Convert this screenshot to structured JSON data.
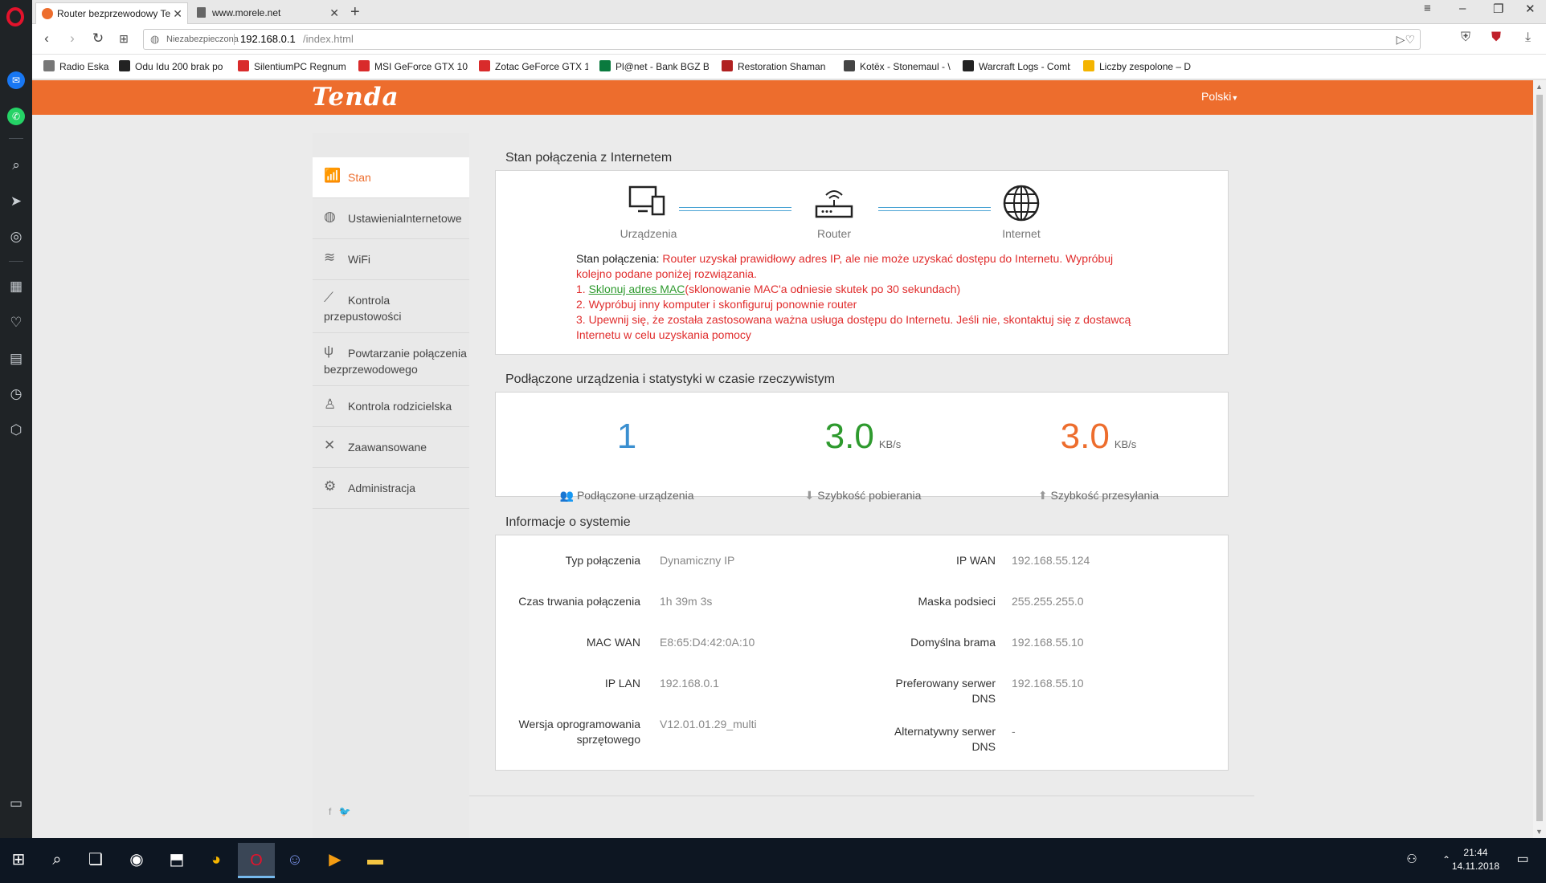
{
  "browser": {
    "tabs": [
      {
        "title": "Router bezprzewodowy Te",
        "active": true
      },
      {
        "title": "www.morele.net",
        "active": false
      }
    ],
    "address": {
      "security": "Niezabezpieczona",
      "host": "192.168.0.1",
      "path": "/index.html"
    },
    "bookmarks": [
      {
        "label": "Radio Eska",
        "color": "#555555"
      },
      {
        "label": "Odu Idu 200 brak po",
        "color": "#222222"
      },
      {
        "label": "SilentiumPC Regnum",
        "color": "#d92b2b"
      },
      {
        "label": "MSI GeForce GTX 10",
        "color": "#d92b2b"
      },
      {
        "label": "Zotac GeForce GTX 1",
        "color": "#d92b2b"
      },
      {
        "label": "Pl@net - Bank BGZ B",
        "color": "#0a7a3e"
      },
      {
        "label": "Restoration Shaman",
        "color": "#b02020"
      },
      {
        "label": "Kotëx - Stonemaul - \\",
        "color": "#444444"
      },
      {
        "label": "Warcraft Logs - Comb",
        "color": "#222222"
      },
      {
        "label": "Liczby zespolone – D",
        "color": "#f4b400"
      }
    ]
  },
  "tenda": {
    "logo": "Tenda",
    "language": "Polski",
    "brand_color": "#ed6d2d",
    "nav": [
      {
        "label": "Stan",
        "icon": "wifi-router-icon",
        "glyph": "🛜"
      },
      {
        "label": "UstawieniaInternetowe",
        "icon": "globe-icon",
        "glyph": "🌐"
      },
      {
        "label": "WiFi",
        "icon": "wifi-icon",
        "glyph": "≋"
      },
      {
        "label_line1": "Kontrola",
        "label_line2": "przepustowości",
        "icon": "chart-line-icon",
        "glyph": "〰"
      },
      {
        "label_line1": "Powtarzanie połączenia",
        "label_line2": "bezprzewodowego",
        "icon": "antenna-icon",
        "glyph": "ψ"
      },
      {
        "label": "Kontrola rodzicielska",
        "icon": "person-icon",
        "glyph": "✦"
      },
      {
        "label": "Zaawansowane",
        "icon": "tools-icon",
        "glyph": "✕"
      },
      {
        "label": "Administracja",
        "icon": "gears-icon",
        "glyph": "⚙"
      }
    ],
    "connection": {
      "title": "Stan połączenia z Internetem",
      "devices_label": "Urządzenia",
      "router_label": "Router",
      "internet_label": "Internet",
      "status_label": "Stan połączenia:",
      "status_text": "Router uzyskał prawidłowy adres IP, ale nie może uzyskać dostępu do Internetu. Wypróbuj kolejno podane poniżej rozwiązania.",
      "step1_prefix": "1.",
      "step1_link": "Sklonuj adres MAC",
      "step1_rest": "(sklonowanie MAC'a odniesie skutek po 30 sekundach)",
      "step2": "2. Wypróbuj inny komputer i skonfiguruj ponownie router",
      "step3": "3. Upewnij się, że została zastosowana ważna usługa dostępu do Internetu. Jeśli nie, skontaktuj się z dostawcą Internetu w celu uzyskania pomocy"
    },
    "stats": {
      "title": "Podłączone urządzenia i statystyki w czasie rzeczywistym",
      "devices_count": "1",
      "devices_label": "Podłączone urządzenia",
      "download_value": "3.0",
      "download_unit": "KB/s",
      "download_label": "Szybkość pobierania",
      "upload_value": "3.0",
      "upload_unit": "KB/s",
      "upload_label": "Szybkość przesyłania",
      "colors": {
        "count": "#3a8fd0",
        "download": "#2e9a2e",
        "upload": "#ed6d2d"
      }
    },
    "system": {
      "title": "Informacje o systemie",
      "left": [
        {
          "key": "Typ połączenia",
          "value": "Dynamiczny IP"
        },
        {
          "key": "Czas trwania połączenia",
          "value": "1h 39m 3s"
        },
        {
          "key": "MAC WAN",
          "value": "E8:65:D4:42:0A:10"
        },
        {
          "key": "IP LAN",
          "value": "192.168.0.1"
        },
        {
          "key_line1": "Wersja oprogramowania",
          "key_line2": "sprzętowego",
          "value": "V12.01.01.29_multi"
        }
      ],
      "right": [
        {
          "key": "IP WAN",
          "value": "192.168.55.124"
        },
        {
          "key": "Maska podsieci",
          "value": "255.255.255.0"
        },
        {
          "key": "Domyślna brama",
          "value": "192.168.55.10"
        },
        {
          "key_line1": "Preferowany serwer",
          "key_line2": "DNS",
          "value": "192.168.55.10"
        },
        {
          "key_line1": "Alternatywny serwer",
          "key_line2": "DNS",
          "value": "-"
        }
      ]
    }
  },
  "taskbar": {
    "time": "21:44",
    "date": "14.11.2018"
  }
}
